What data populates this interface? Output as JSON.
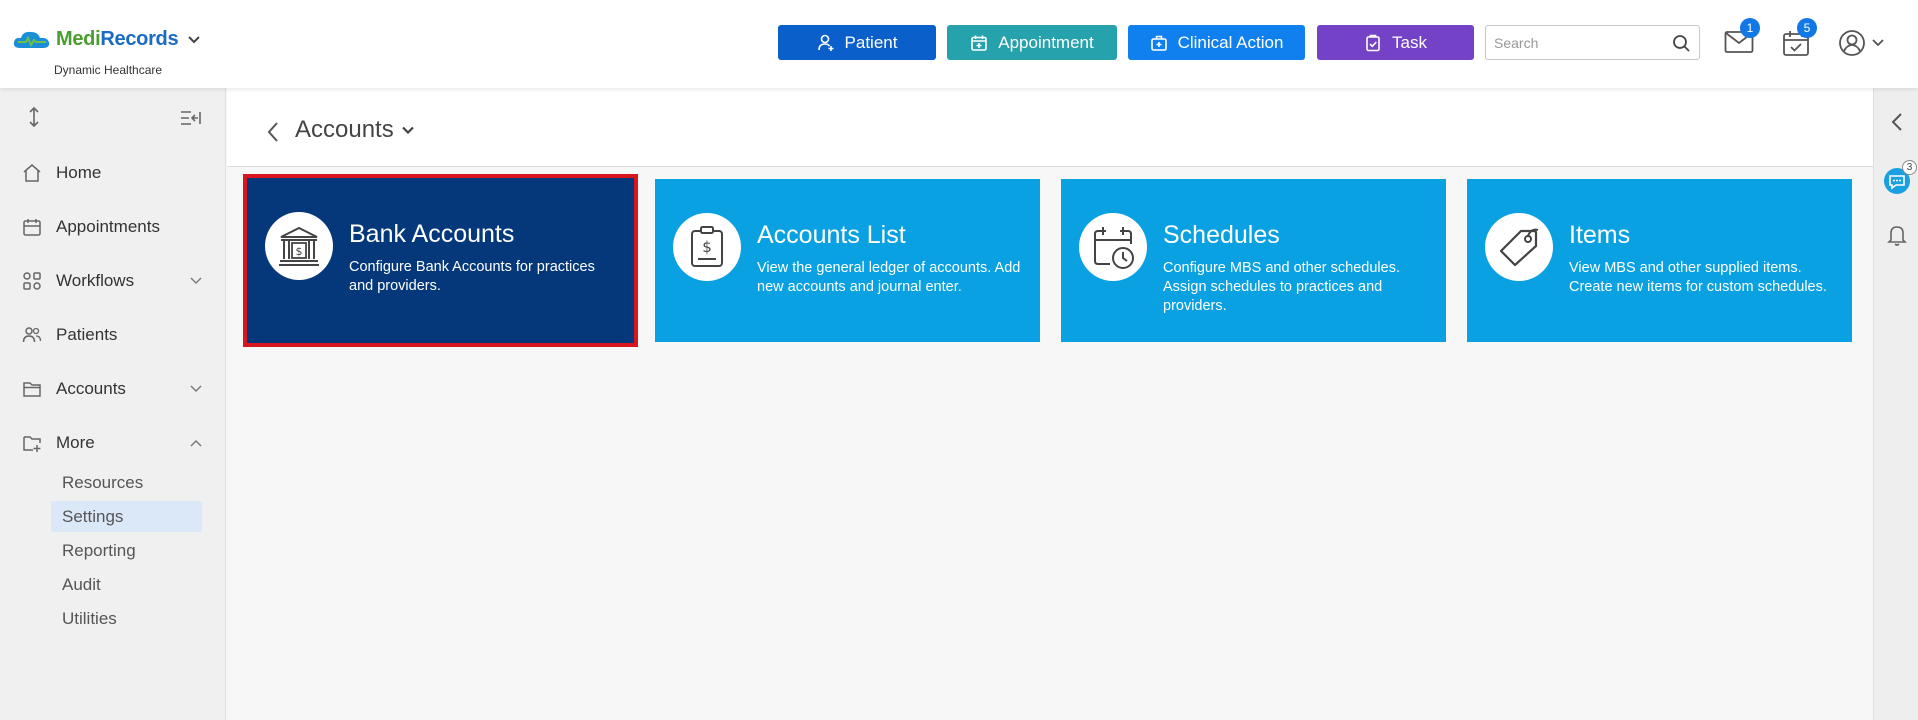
{
  "app": {
    "logo_medi": "Medi",
    "logo_records": "Records",
    "subtitle": "Dynamic Healthcare"
  },
  "header": {
    "buttons": {
      "patient": "Patient",
      "appointment": "Appointment",
      "clinical_action": "Clinical Action",
      "task": "Task"
    },
    "search_placeholder": "Search",
    "mail_badge": "1",
    "tasks_badge": "5"
  },
  "sidebar": {
    "items": [
      {
        "label": "Home",
        "icon": "home-icon"
      },
      {
        "label": "Appointments",
        "icon": "calendar-icon"
      },
      {
        "label": "Workflows",
        "icon": "workflow-icon",
        "expandable": true
      },
      {
        "label": "Patients",
        "icon": "users-icon"
      },
      {
        "label": "Accounts",
        "icon": "folder-icon",
        "expandable": true
      },
      {
        "label": "More",
        "icon": "folder-plus-icon",
        "expanded": true
      }
    ],
    "sub_items": [
      {
        "label": "Resources"
      },
      {
        "label": "Settings",
        "active": true
      },
      {
        "label": "Reporting"
      },
      {
        "label": "Audit"
      },
      {
        "label": "Utilities"
      }
    ]
  },
  "breadcrumb": {
    "title": "Accounts"
  },
  "cards": [
    {
      "title": "Bank Accounts",
      "description": "Configure Bank Accounts for practices and providers.",
      "icon": "bank-icon",
      "selected": true
    },
    {
      "title": "Accounts List",
      "description": "View the general ledger of accounts. Add new accounts and journal enter.",
      "icon": "ledger-icon"
    },
    {
      "title": "Schedules",
      "description": "Configure MBS and other schedules. Assign schedules to practices and providers.",
      "icon": "schedule-icon"
    },
    {
      "title": "Items",
      "description": "View MBS and other supplied items. Create new items for custom schedules.",
      "icon": "tag-icon"
    }
  ],
  "rail": {
    "chat_badge": "3"
  },
  "colors": {
    "card": "#0aa1e2",
    "card_selected": "#05387a",
    "highlight": "#d9161d",
    "patient_btn": "#0b5fca",
    "appointment_btn": "#26a2ad",
    "clinical_btn": "#1180ef",
    "task_btn": "#7342c6"
  }
}
